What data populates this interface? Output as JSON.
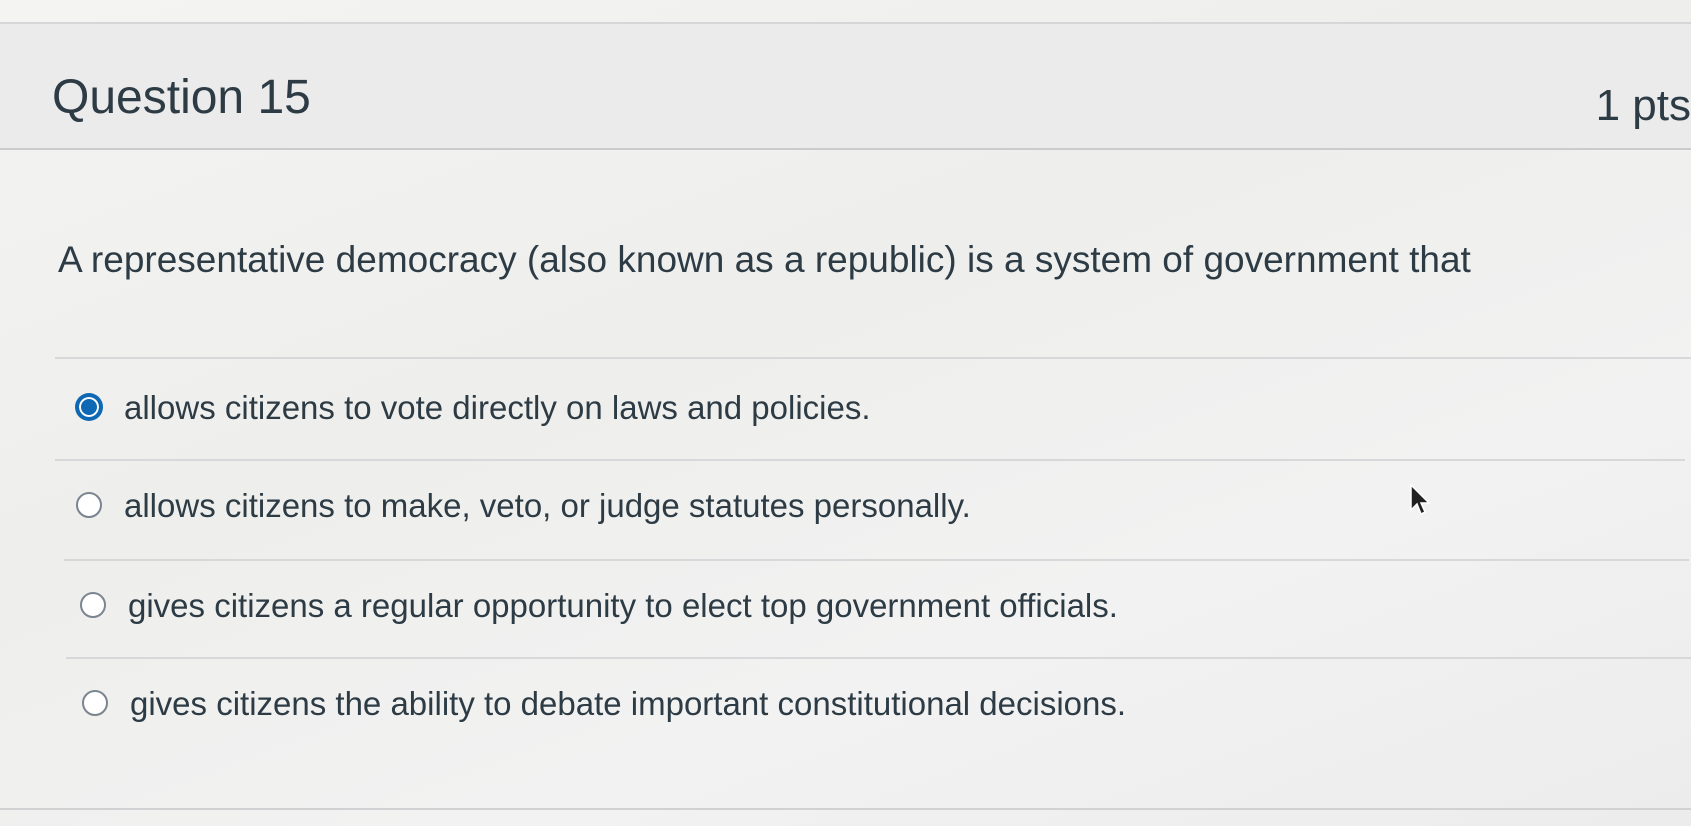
{
  "question": {
    "title": "Question 15",
    "points": "1 pts",
    "text": "A representative democracy (also known as a republic) is a system of government that"
  },
  "answers": [
    {
      "label": "allows citizens to vote directly on laws and policies.",
      "selected": true
    },
    {
      "label": "allows citizens to make, veto, or judge statutes personally.",
      "selected": false
    },
    {
      "label": "gives citizens a regular opportunity to elect top government officials.",
      "selected": false
    },
    {
      "label": "gives citizens the ability to debate important constitutional decisions.",
      "selected": false
    }
  ],
  "colors": {
    "accent": "#0e68b3",
    "text": "#2d3b45",
    "header_bg": "#ebebeb"
  },
  "icons": {
    "cursor": "mouse-pointer-icon"
  }
}
